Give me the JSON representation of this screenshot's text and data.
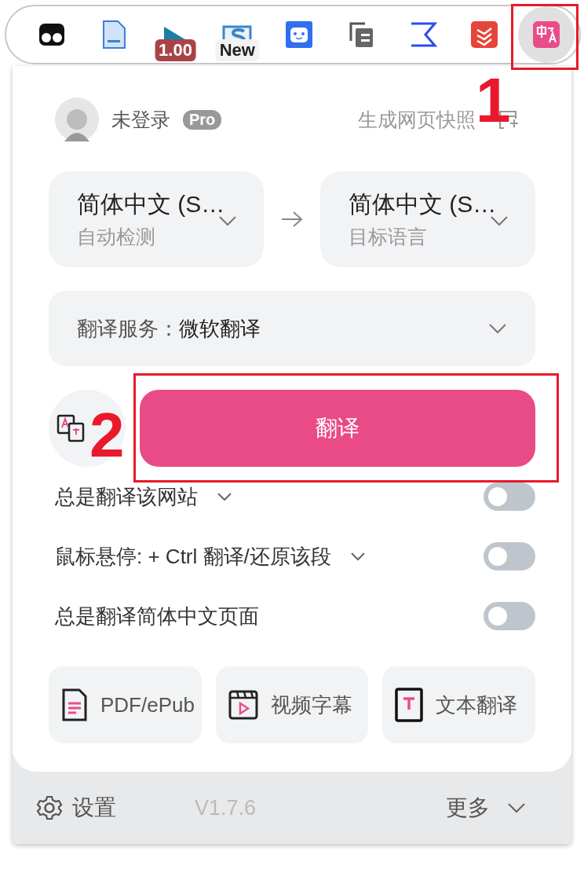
{
  "toolbar": {
    "extensions": [
      {
        "kind": "eyes",
        "selected": false
      },
      {
        "kind": "doc",
        "selected": false
      },
      {
        "kind": "flag",
        "badge": "1.00",
        "selected": false
      },
      {
        "kind": "s",
        "badge": "New",
        "selected": false
      },
      {
        "kind": "robot",
        "selected": false
      },
      {
        "kind": "pages",
        "selected": false
      },
      {
        "kind": "sigma",
        "selected": false
      },
      {
        "kind": "layers",
        "selected": false
      },
      {
        "kind": "translate",
        "selected": true
      }
    ]
  },
  "popup": {
    "user": {
      "name": "未登录",
      "badge": "Pro"
    },
    "snapshot": "生成网页快照",
    "source": {
      "language": "简体中文 (S…",
      "caption": "自动检测"
    },
    "target": {
      "language": "简体中文 (S…",
      "caption": "目标语言"
    },
    "service": {
      "label": "翻译服务：",
      "value": "微软翻译"
    },
    "translate_button": "翻译",
    "options": [
      {
        "label": "总是翻译该网站",
        "dropdown": true,
        "on": false
      },
      {
        "label": "鼠标悬停:  + Ctrl 翻译/还原该段",
        "dropdown": true,
        "on": false
      },
      {
        "label": "总是翻译简体中文页面",
        "dropdown": false,
        "on": false
      }
    ],
    "tools": [
      {
        "kind": "pdf",
        "label": "PDF/ePub"
      },
      {
        "kind": "video",
        "label": "视频字幕"
      },
      {
        "kind": "text",
        "label": "文本翻译"
      }
    ],
    "footer": {
      "settings": "设置",
      "version": "V1.7.6",
      "more": "更多"
    }
  },
  "annotations": [
    {
      "label": "1"
    },
    {
      "label": "2"
    }
  ]
}
